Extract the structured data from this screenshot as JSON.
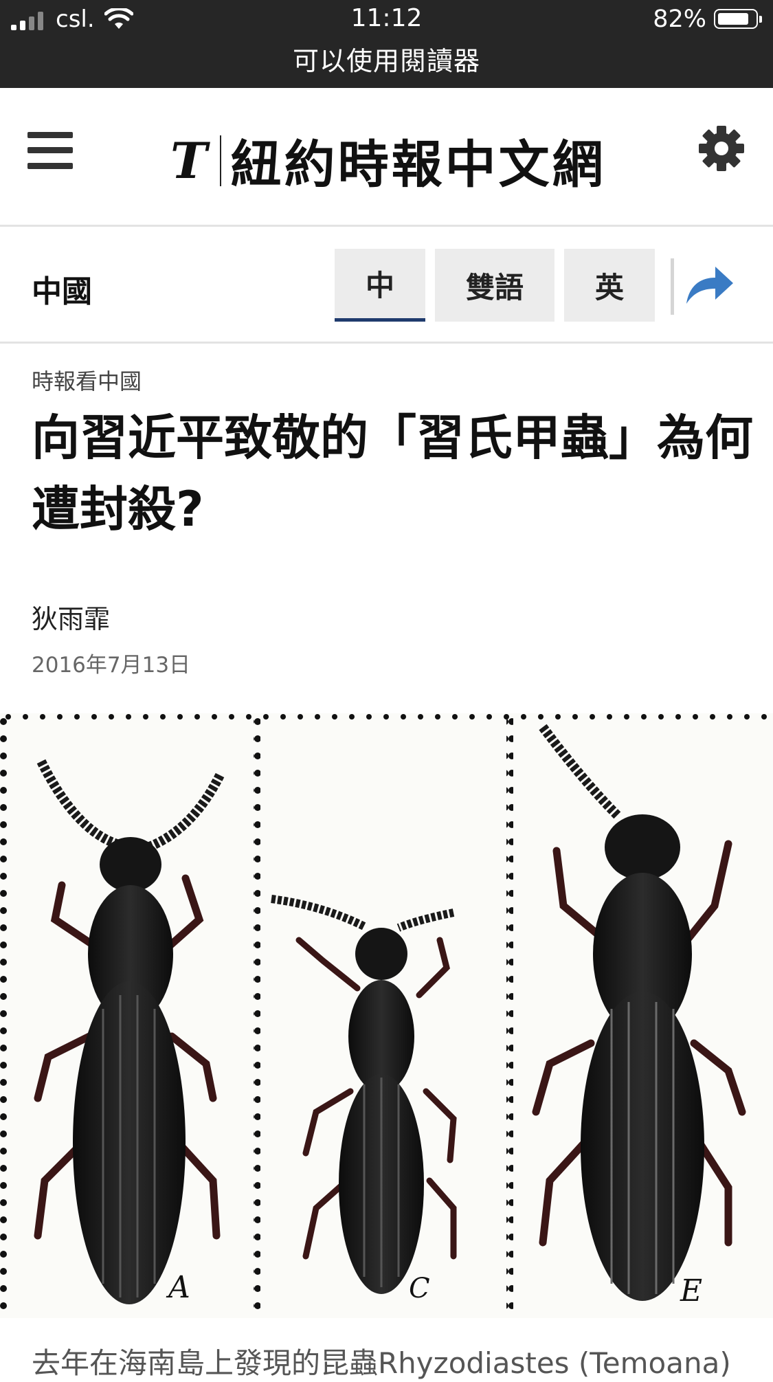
{
  "status_bar": {
    "carrier": "csl.",
    "time": "11:12",
    "battery": "82%",
    "battery_level": 0.82,
    "reader_notice": "可以使用閱讀器"
  },
  "header": {
    "logo_mark": "T",
    "logo_text": "紐約時報中文網",
    "icons": [
      "menu-icon",
      "gear-icon"
    ]
  },
  "section_bar": {
    "section": "中國",
    "lang_tabs": [
      {
        "label": "中",
        "active": true
      },
      {
        "label": "雙語",
        "active": false
      },
      {
        "label": "英",
        "active": false
      }
    ],
    "share_icon": "share-arrow-icon",
    "share_color": "#3a7bc4",
    "active_underline_color": "#1f3b6d"
  },
  "article": {
    "kicker": "時報看中國",
    "headline": "向習近平致敬的「習氏甲蟲」為何遭封殺?",
    "author": "狄雨霏",
    "date": "2016年7月13日"
  },
  "photo": {
    "panel_labels": [
      "A",
      "C",
      "E"
    ]
  },
  "caption": "去年在海南島上發現的昆蟲Rhyzodiastes (Temoana)"
}
